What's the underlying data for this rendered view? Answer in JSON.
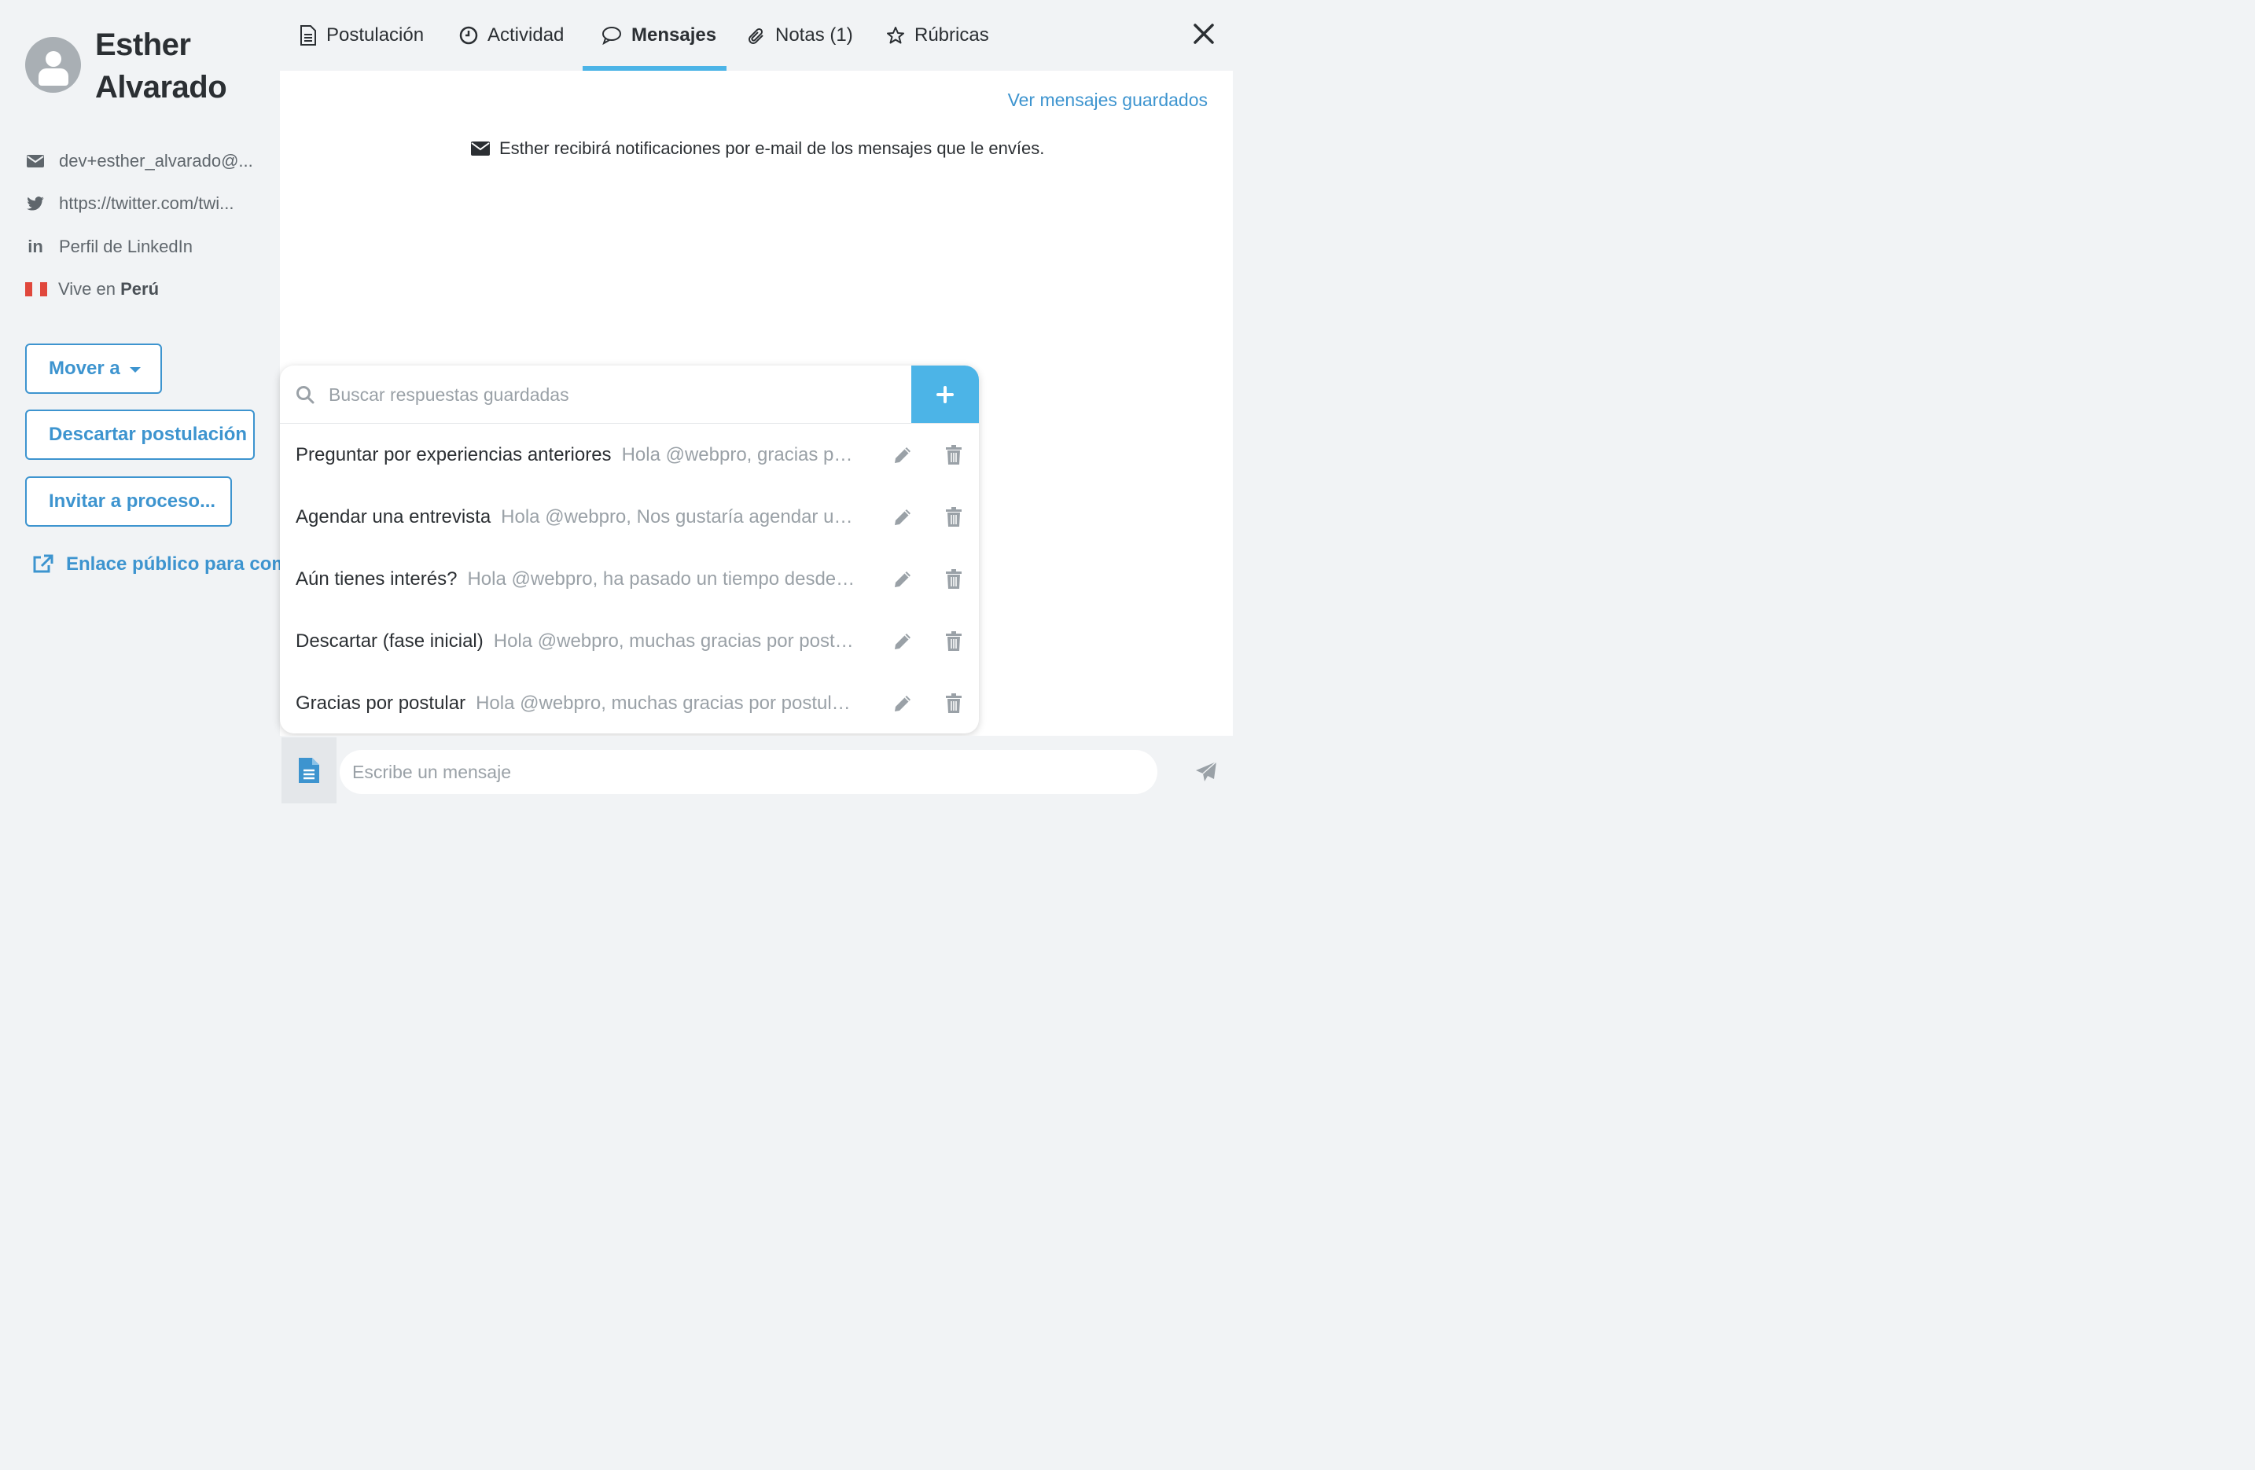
{
  "candidate": {
    "first_name": "Esther",
    "last_name": "Alvarado",
    "email": "dev+esther_alvarado@...",
    "twitter": "https://twitter.com/twi...",
    "linkedin": "Perfil de LinkedIn",
    "lives_prefix": "Vive en",
    "country": "Perú"
  },
  "actions": {
    "move_label": "Mover a",
    "discard_label": "Descartar postulación",
    "invite_label": "Invitar a proceso...",
    "public_link_label": "Enlace público para comp"
  },
  "tabs": [
    {
      "label": "Postulación",
      "icon": "document-icon"
    },
    {
      "label": "Actividad",
      "icon": "clock-icon"
    },
    {
      "label": "Mensajes",
      "icon": "chat-bubble-icon",
      "active": true
    },
    {
      "label": "Notas (1)",
      "icon": "paperclip-icon"
    },
    {
      "label": "Rúbricas",
      "icon": "star-icon"
    }
  ],
  "messages": {
    "saved_link": "Ver mensajes guardados",
    "notice": "Esther recibirá notificaciones por e-mail de los mensajes que le envíes."
  },
  "saved_responses": {
    "search_placeholder": "Buscar respuestas guardadas",
    "items": [
      {
        "title": "Preguntar por experiencias anteriores",
        "preview": "Hola @webpro, gracias po..."
      },
      {
        "title": "Agendar una entrevista",
        "preview": "Hola @webpro, Nos gustaría agendar un..."
      },
      {
        "title": "Aún tienes interés?",
        "preview": "Hola @webpro, ha pasado un tiempo desde l..."
      },
      {
        "title": "Descartar (fase inicial)",
        "preview": "Hola @webpro, muchas gracias por postu..."
      },
      {
        "title": "Gracias por postular",
        "preview": "Hola @webpro, muchas gracias por postula..."
      }
    ]
  },
  "composer": {
    "placeholder": "Escribe un mensaje"
  },
  "colors": {
    "accent": "#3d94cf",
    "tab_underline": "#4cb4e7",
    "add_button": "#4cb4e7",
    "flag_red": "#e0473c"
  }
}
